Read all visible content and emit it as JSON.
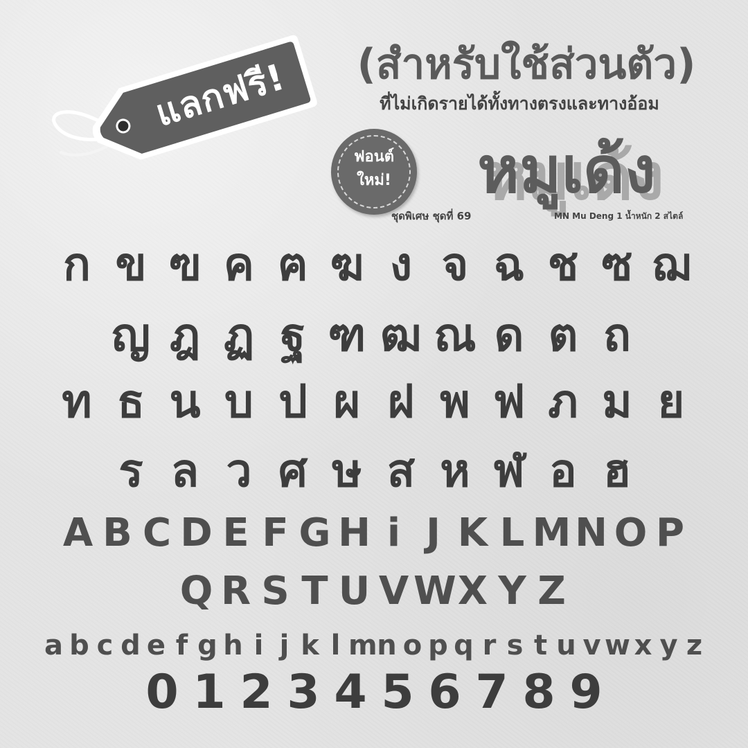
{
  "tag": {
    "label": "แลกฟรี!"
  },
  "heading": {
    "line1": "(สำหรับใช้ส่วนตัว)",
    "line2": "ที่ไม่เกิดรายได้ทั้งทางตรงและทางอ้อม"
  },
  "badge": {
    "line1": "ฟอนต์",
    "line2": "ใหม่!"
  },
  "font_name": "หมูเด้ง",
  "info": {
    "series": "ชุดพิเศษ ชุดที่ 69",
    "name_weight": "MN Mu Deng 1 น้ำหนัก 2 สไตล์"
  },
  "glyph_rows": {
    "thai_1": [
      "ก",
      "ข",
      "ฃ",
      "ค",
      "ฅ",
      "ฆ",
      "ง",
      "จ",
      "ฉ",
      "ช",
      "ซ",
      "ฌ"
    ],
    "thai_2": [
      "ญ",
      "ฎ",
      "ฏ",
      "ฐ",
      "ฑ",
      "ฒ",
      "ณ",
      "ด",
      "ต",
      "ถ"
    ],
    "thai_3": [
      "ท",
      "ธ",
      "น",
      "บ",
      "ป",
      "ผ",
      "ฝ",
      "พ",
      "ฟ",
      "ภ",
      "ม",
      "ย"
    ],
    "thai_4": [
      "ร",
      "ล",
      "ว",
      "ศ",
      "ษ",
      "ส",
      "ห",
      "ฬ",
      "อ",
      "ฮ"
    ],
    "upper_1": [
      "A",
      "B",
      "C",
      "D",
      "E",
      "F",
      "G",
      "H",
      "i",
      "J",
      "K",
      "L",
      "M",
      "N",
      "O",
      "P"
    ],
    "upper_2": [
      "Q",
      "R",
      "S",
      "T",
      "U",
      "V",
      "W",
      "X",
      "Y",
      "Z"
    ],
    "lower": [
      "a",
      "b",
      "c",
      "d",
      "e",
      "f",
      "g",
      "h",
      "i",
      "j",
      "k",
      "l",
      "m",
      "n",
      "o",
      "p",
      "q",
      "r",
      "s",
      "t",
      "u",
      "v",
      "w",
      "x",
      "y",
      "z"
    ],
    "digits": [
      "0",
      "1",
      "2",
      "3",
      "4",
      "5",
      "6",
      "7",
      "8",
      "9"
    ]
  },
  "colors": {
    "background": "#e4e4e4",
    "tag": "#5f5f5f",
    "glyph": "#3d3d3d",
    "latin": "#4f4f4f",
    "title_shadow": "#a9a9a9"
  }
}
